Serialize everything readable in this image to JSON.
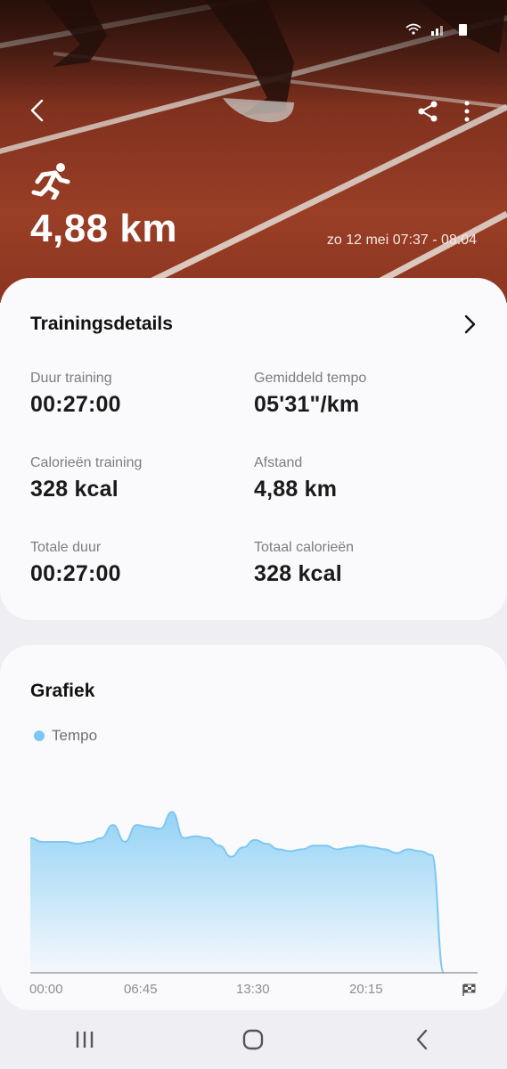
{
  "header": {
    "distance": "4,88 km",
    "date_range": "zo 12 mei 07:37 - 08:04",
    "icons": [
      "back-arrow-icon",
      "share-icon",
      "more-options-icon",
      "running-icon"
    ]
  },
  "details": {
    "title": "Trainingsdetails",
    "stats": [
      {
        "label": "Duur training",
        "value": "00:27:00"
      },
      {
        "label": "Gemiddeld tempo",
        "value": "05'31\"/km"
      },
      {
        "label": "Calorieën training",
        "value": "328 kcal"
      },
      {
        "label": "Afstand",
        "value": "4,88 km"
      },
      {
        "label": "Totale duur",
        "value": "00:27:00"
      },
      {
        "label": "Totaal calorieën",
        "value": "328 kcal"
      }
    ]
  },
  "graph": {
    "title": "Grafiek",
    "legend": "Tempo",
    "color": "#7cc8f2",
    "x_ticks": [
      "00:00",
      "06:45",
      "13:30",
      "20:15"
    ],
    "finish_icon": "checkered-flag-icon"
  },
  "chart_data": {
    "type": "area",
    "title": "",
    "series": [
      {
        "name": "Tempo",
        "values": [
          0.72,
          0.7,
          0.7,
          0.7,
          0.69,
          0.7,
          0.72,
          0.79,
          0.7,
          0.79,
          0.78,
          0.77,
          0.86,
          0.72,
          0.73,
          0.72,
          0.68,
          0.62,
          0.67,
          0.71,
          0.69,
          0.66,
          0.65,
          0.66,
          0.68,
          0.68,
          0.66,
          0.67,
          0.68,
          0.67,
          0.66,
          0.64,
          0.66,
          0.65,
          0.63,
          0.0
        ]
      }
    ],
    "x": [
      "00:00",
      "",
      "",
      "",
      "",
      "",
      "06:45",
      "",
      "",
      "",
      "",
      "",
      "",
      "",
      "",
      "",
      "",
      "13:30",
      "",
      "",
      "",
      "",
      "",
      "",
      "",
      "",
      "",
      "20:15",
      "",
      "",
      "",
      "",
      "",
      "",
      "",
      ""
    ],
    "ylim": [
      0,
      1
    ],
    "grid": false
  },
  "nav": {
    "icons": [
      "recent-apps-icon",
      "home-icon",
      "back-icon"
    ]
  }
}
